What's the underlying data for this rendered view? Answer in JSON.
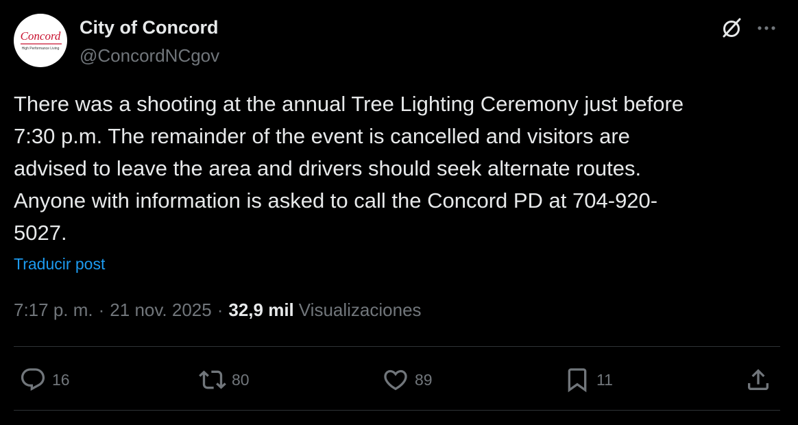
{
  "author": {
    "display_name": "City of Concord",
    "handle": "@ConcordNCgov",
    "avatar_text": "Concord",
    "avatar_tagline": "High Performance Living"
  },
  "header_icons": {
    "grok": "grok-icon",
    "more": "more-icon"
  },
  "post": {
    "text": "There was a shooting at the annual Tree Lighting Ceremony just before\n7:30 p.m. The remainder of the event is cancelled and visitors are\nadvised to leave the area and drivers should seek alternate routes.\n Anyone with information is asked to call the Concord PD at 704-920-\n5027.",
    "translate_label": "Traducir post"
  },
  "meta": {
    "time": "7:17 p. m.",
    "separator": "·",
    "date": "21 nov. 2025",
    "views_count": "32,9 mil",
    "views_label": "Visualizaciones"
  },
  "actions": {
    "replies": "16",
    "reposts": "80",
    "likes": "89",
    "bookmarks": "11"
  },
  "colors": {
    "background": "#000000",
    "text": "#e7e9ea",
    "muted": "#71767b",
    "link": "#1d9bf0",
    "divider": "#2f3336",
    "logo_red": "#c8102e"
  }
}
